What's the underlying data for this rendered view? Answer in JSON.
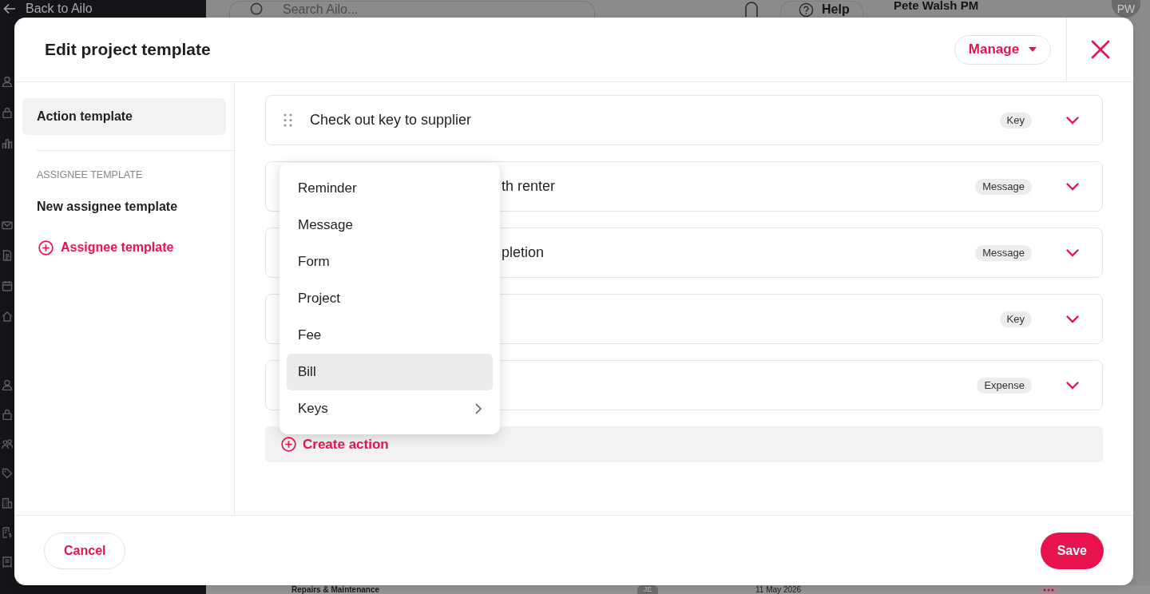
{
  "app_background": {
    "back_link": "Back to Ailo",
    "search": {
      "placeholder": "Search Ailo..."
    },
    "help_button": "Help",
    "user_name": "Pete Walsh PM",
    "avatar": "PW",
    "list_row": {
      "title": "Repairs & Maintenance",
      "assignee": "JE",
      "date": "11 May 2026"
    }
  },
  "dialog": {
    "title": "Edit project template",
    "manage_button": "Manage",
    "sidebar": {
      "items": [
        {
          "label": "Action template",
          "selected": true
        }
      ],
      "assignee_section": {
        "heading": "ASSIGNEE TEMPLATE",
        "items": [
          {
            "label": "New assignee template",
            "selected": false
          }
        ],
        "add_button": "Assignee template"
      }
    },
    "actions": [
      {
        "title": "Check out key to supplier",
        "tag": "Key"
      },
      {
        "title": "th renter",
        "tag": "Message"
      },
      {
        "title": "pletion",
        "tag": "Message"
      },
      {
        "tag": "Key"
      },
      {
        "tag": "Expense"
      }
    ],
    "create_button": "Create action",
    "menu": {
      "items": [
        {
          "label": "Reminder",
          "kind": "item",
          "selected": false
        },
        {
          "label": "Message",
          "kind": "item",
          "selected": false
        },
        {
          "label": "Form",
          "kind": "item",
          "selected": false
        },
        {
          "label": "Project",
          "kind": "item",
          "selected": false
        },
        {
          "label": "Fee",
          "kind": "item",
          "selected": false
        },
        {
          "label": "Bill",
          "kind": "item",
          "selected": true
        },
        {
          "label": "Keys",
          "kind": "submenu",
          "selected": false
        }
      ]
    },
    "footer": {
      "cancel_button": "Cancel",
      "save_button": "Save"
    }
  }
}
